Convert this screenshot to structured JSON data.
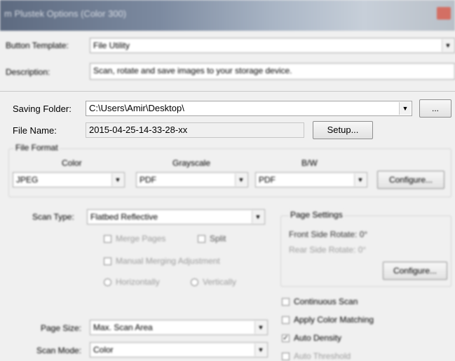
{
  "window": {
    "title": "m Plustek Options (Color 300)"
  },
  "button_template": {
    "label": "Button Template:",
    "value": "File Utility"
  },
  "description": {
    "label": "Description:",
    "value": "Scan, rotate and save images to your storage device."
  },
  "saving_folder": {
    "label": "Saving Folder:",
    "value": "C:\\Users\\Amir\\Desktop\\",
    "browse_label": "..."
  },
  "file_name": {
    "label": "File Name:",
    "value": "2015-04-25-14-33-28-xx",
    "setup_label": "Setup..."
  },
  "file_format": {
    "label": "File Format",
    "color_label": "Color",
    "color_value": "JPEG",
    "grayscale_label": "Grayscale",
    "grayscale_value": "PDF",
    "bw_label": "B/W",
    "bw_value": "PDF",
    "configure_label": "Configure..."
  },
  "scan": {
    "scan_type_label": "Scan Type:",
    "scan_type_value": "Flatbed Reflective",
    "merge_pages_label": "Merge Pages",
    "split_label": "Split",
    "manual_merging_label": "Manual Merging Adjustment",
    "horizontally_label": "Horizontally",
    "vertically_label": "Vertically",
    "page_size_label": "Page Size:",
    "page_size_value": "Max. Scan Area",
    "scan_mode_label": "Scan Mode:",
    "scan_mode_value": "Color"
  },
  "page_settings": {
    "label": "Page Settings",
    "front_rotate": "Front Side Rotate: 0°",
    "rear_rotate": "Rear Side Rotate: 0°",
    "configure_label": "Configure..."
  },
  "options": {
    "continuous_scan": "Continuous Scan",
    "apply_color_matching": "Apply Color Matching",
    "auto_density": "Auto Density",
    "auto_threshold": "Auto Threshold",
    "auto_density_checked": "✓"
  }
}
